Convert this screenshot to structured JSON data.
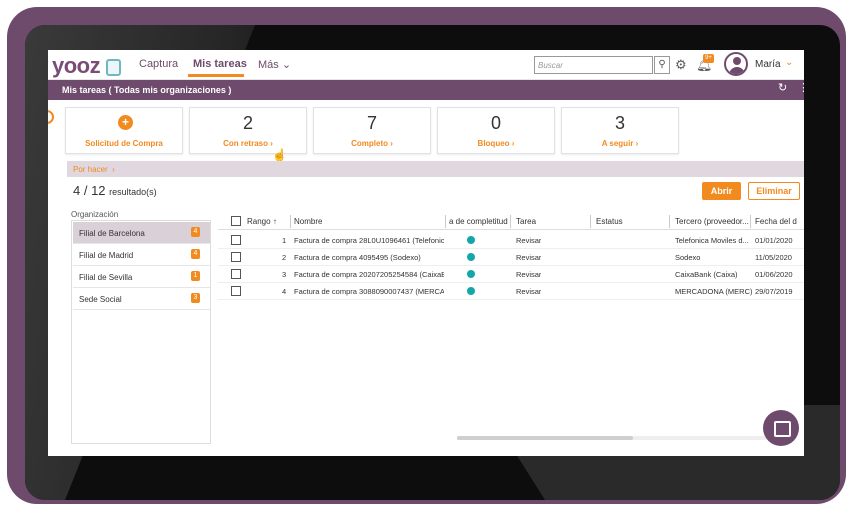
{
  "header": {
    "logo": "yooz",
    "nav": [
      "Captura",
      "Mis tareas",
      "Más"
    ],
    "search_placeholder": "Buscar",
    "notif_badge": "9+",
    "user": "María"
  },
  "title": "Mis tareas ( Todas mis organizaciones )",
  "cards": [
    {
      "label": "Solicitud de Compra",
      "value": ""
    },
    {
      "label": "Con retraso",
      "value": "2"
    },
    {
      "label": "Completo",
      "value": "7"
    },
    {
      "label": "Bloqueo",
      "value": "0"
    },
    {
      "label": "A seguir",
      "value": "3"
    }
  ],
  "section": "Por hacer",
  "results": {
    "shown": "4 / 12",
    "label": "resultado(s)"
  },
  "buttons": {
    "open": "Abrir",
    "delete": "Eliminar"
  },
  "organizations": {
    "label": "Organización",
    "items": [
      {
        "name": "Filial de Barcelona",
        "count": "4"
      },
      {
        "name": "Filial de Madrid",
        "count": "4"
      },
      {
        "name": "Filial de Sevilla",
        "count": "1"
      },
      {
        "name": "Sede Social",
        "count": "3"
      }
    ]
  },
  "table": {
    "columns": [
      "Rango",
      "Nombre",
      "a de completitud",
      "Tarea",
      "Estatus",
      "Tercero (proveedor...",
      "Fecha del d"
    ],
    "rows": [
      {
        "rank": "1",
        "name": "Factura de compra 28L0U1096461 (Telefonic...",
        "task": "Revisar",
        "status": "",
        "third": "Telefonica Moviles d...",
        "date": "01/01/2020"
      },
      {
        "rank": "2",
        "name": "Factura de compra 4095495 (Sodexo)",
        "task": "Revisar",
        "status": "",
        "third": "Sodexo",
        "date": "11/05/2020"
      },
      {
        "rank": "3",
        "name": "Factura de compra 20207205254584 (CaixaB...",
        "task": "Revisar",
        "status": "",
        "third": "CaixaBank (Caixa)",
        "date": "01/06/2020"
      },
      {
        "rank": "4",
        "name": "Factura de compra 3088090007437 (MERCA...",
        "task": "Revisar",
        "status": "",
        "third": "MERCADONA (MERC)",
        "date": "29/07/2019"
      }
    ]
  },
  "colors": {
    "brand": "#6e4b6d",
    "accent": "#f18a1f",
    "dot": "#14a6a8"
  },
  "icons": [
    "search-icon",
    "gear-icon",
    "bell-icon",
    "avatar-icon",
    "refresh-icon",
    "menu-dots-icon",
    "chat-icon"
  ]
}
